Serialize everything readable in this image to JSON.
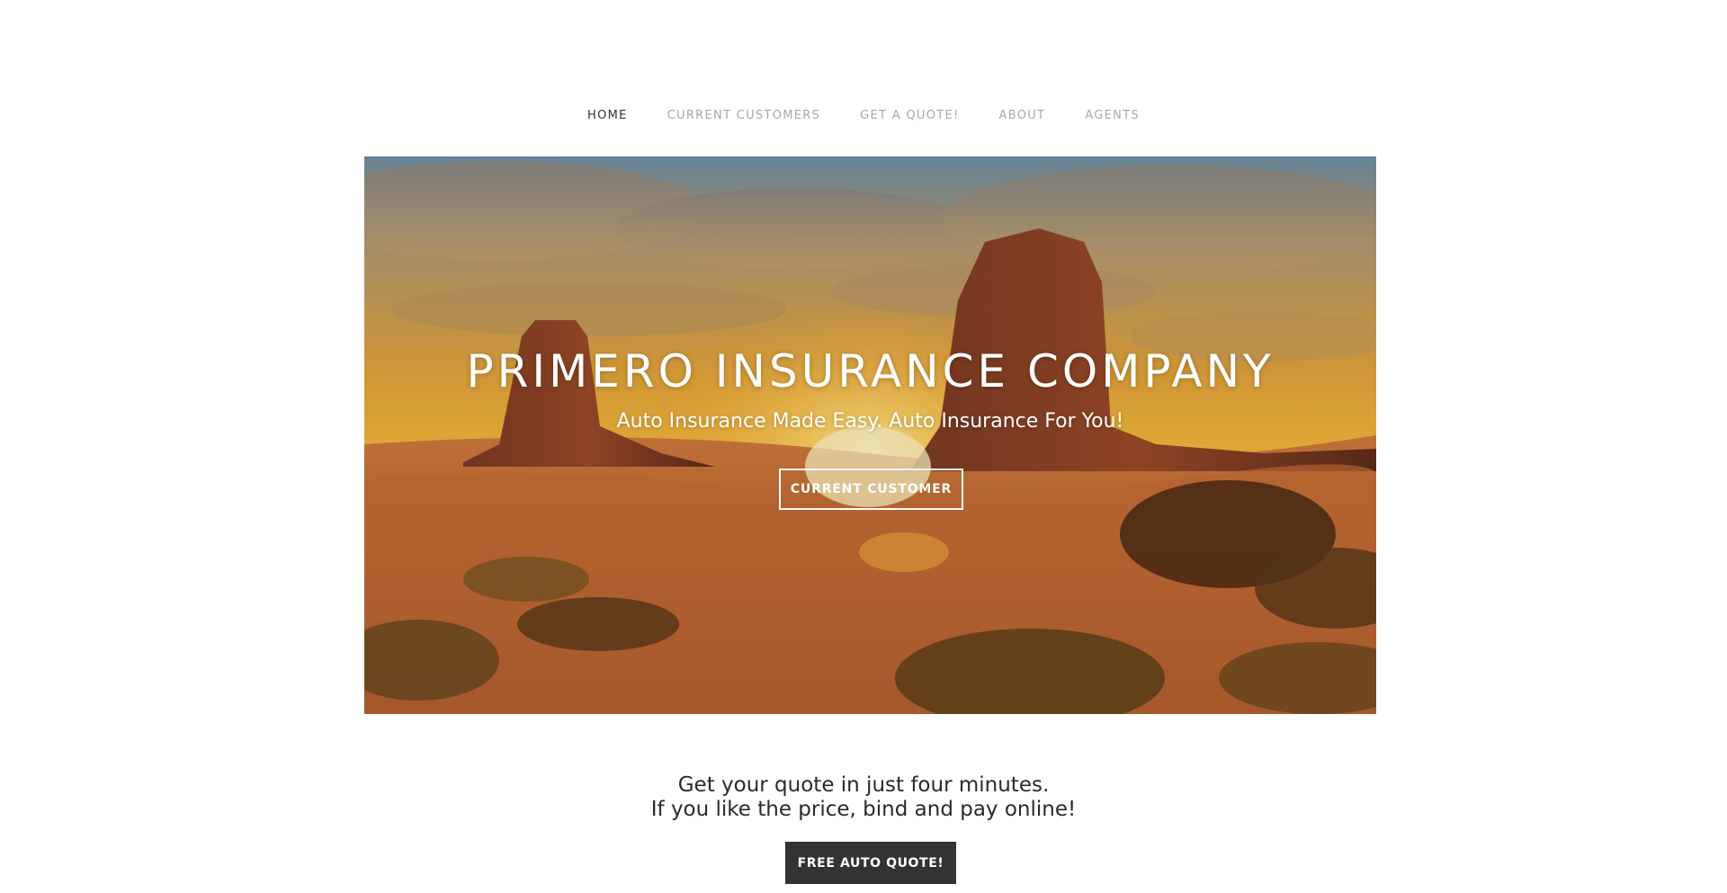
{
  "nav": {
    "items": [
      {
        "label": "HOME",
        "active": true
      },
      {
        "label": "CURRENT CUSTOMERS",
        "active": false
      },
      {
        "label": "GET A QUOTE!",
        "active": false
      },
      {
        "label": "ABOUT",
        "active": false
      },
      {
        "label": "AGENTS",
        "active": false
      }
    ]
  },
  "hero": {
    "title": "PRIMERO INSURANCE COMPANY",
    "subtitle": "Auto Insurance Made Easy. Auto Insurance For You!",
    "button_label": "CURRENT CUSTOMER",
    "background": "desert-sunset-image"
  },
  "tagline": {
    "line1": "Get your quote in just four minutes.",
    "line2": "If you like the price, bind and pay online!"
  },
  "cta": {
    "label": "FREE AUTO QUOTE!"
  },
  "colors": {
    "nav_active": "#333333",
    "nav_inactive": "#a8a8a8",
    "cta_bg": "#333333",
    "text_dark": "#2a2a2a"
  }
}
